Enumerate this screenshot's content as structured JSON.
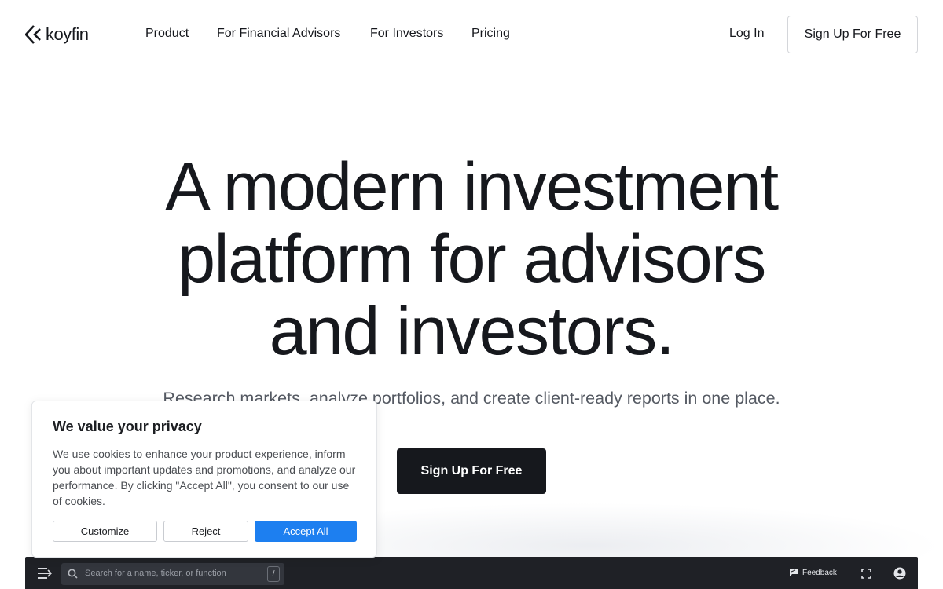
{
  "header": {
    "logo_text": "koyfin",
    "nav": [
      "Product",
      "For Financial Advisors",
      "For Investors",
      "Pricing"
    ],
    "login_label": "Log In",
    "signup_label": "Sign Up For Free"
  },
  "hero": {
    "title_line1": "A modern investment",
    "title_line2": "platform for advisors",
    "title_line3": "and investors.",
    "subtitle": "Research markets, analyze portfolios, and create client-ready reports in one place.",
    "cta_label": "Sign Up For Free"
  },
  "app_preview": {
    "search_placeholder": "Search for a name, ticker, or function",
    "shortcut_key": "/",
    "feedback_label": "Feedback"
  },
  "cookie_banner": {
    "title": "We value your privacy",
    "text": "We use cookies to enhance your product experience, inform you about important updates and promotions, and analyze our performance. By clicking \"Accept All\", you consent to our use of cookies.",
    "customize_label": "Customize",
    "reject_label": "Reject",
    "accept_label": "Accept All"
  },
  "colors": {
    "text_dark": "#16181d",
    "accept_blue": "#1d7ff0",
    "app_bar_bg": "#1f2126"
  }
}
